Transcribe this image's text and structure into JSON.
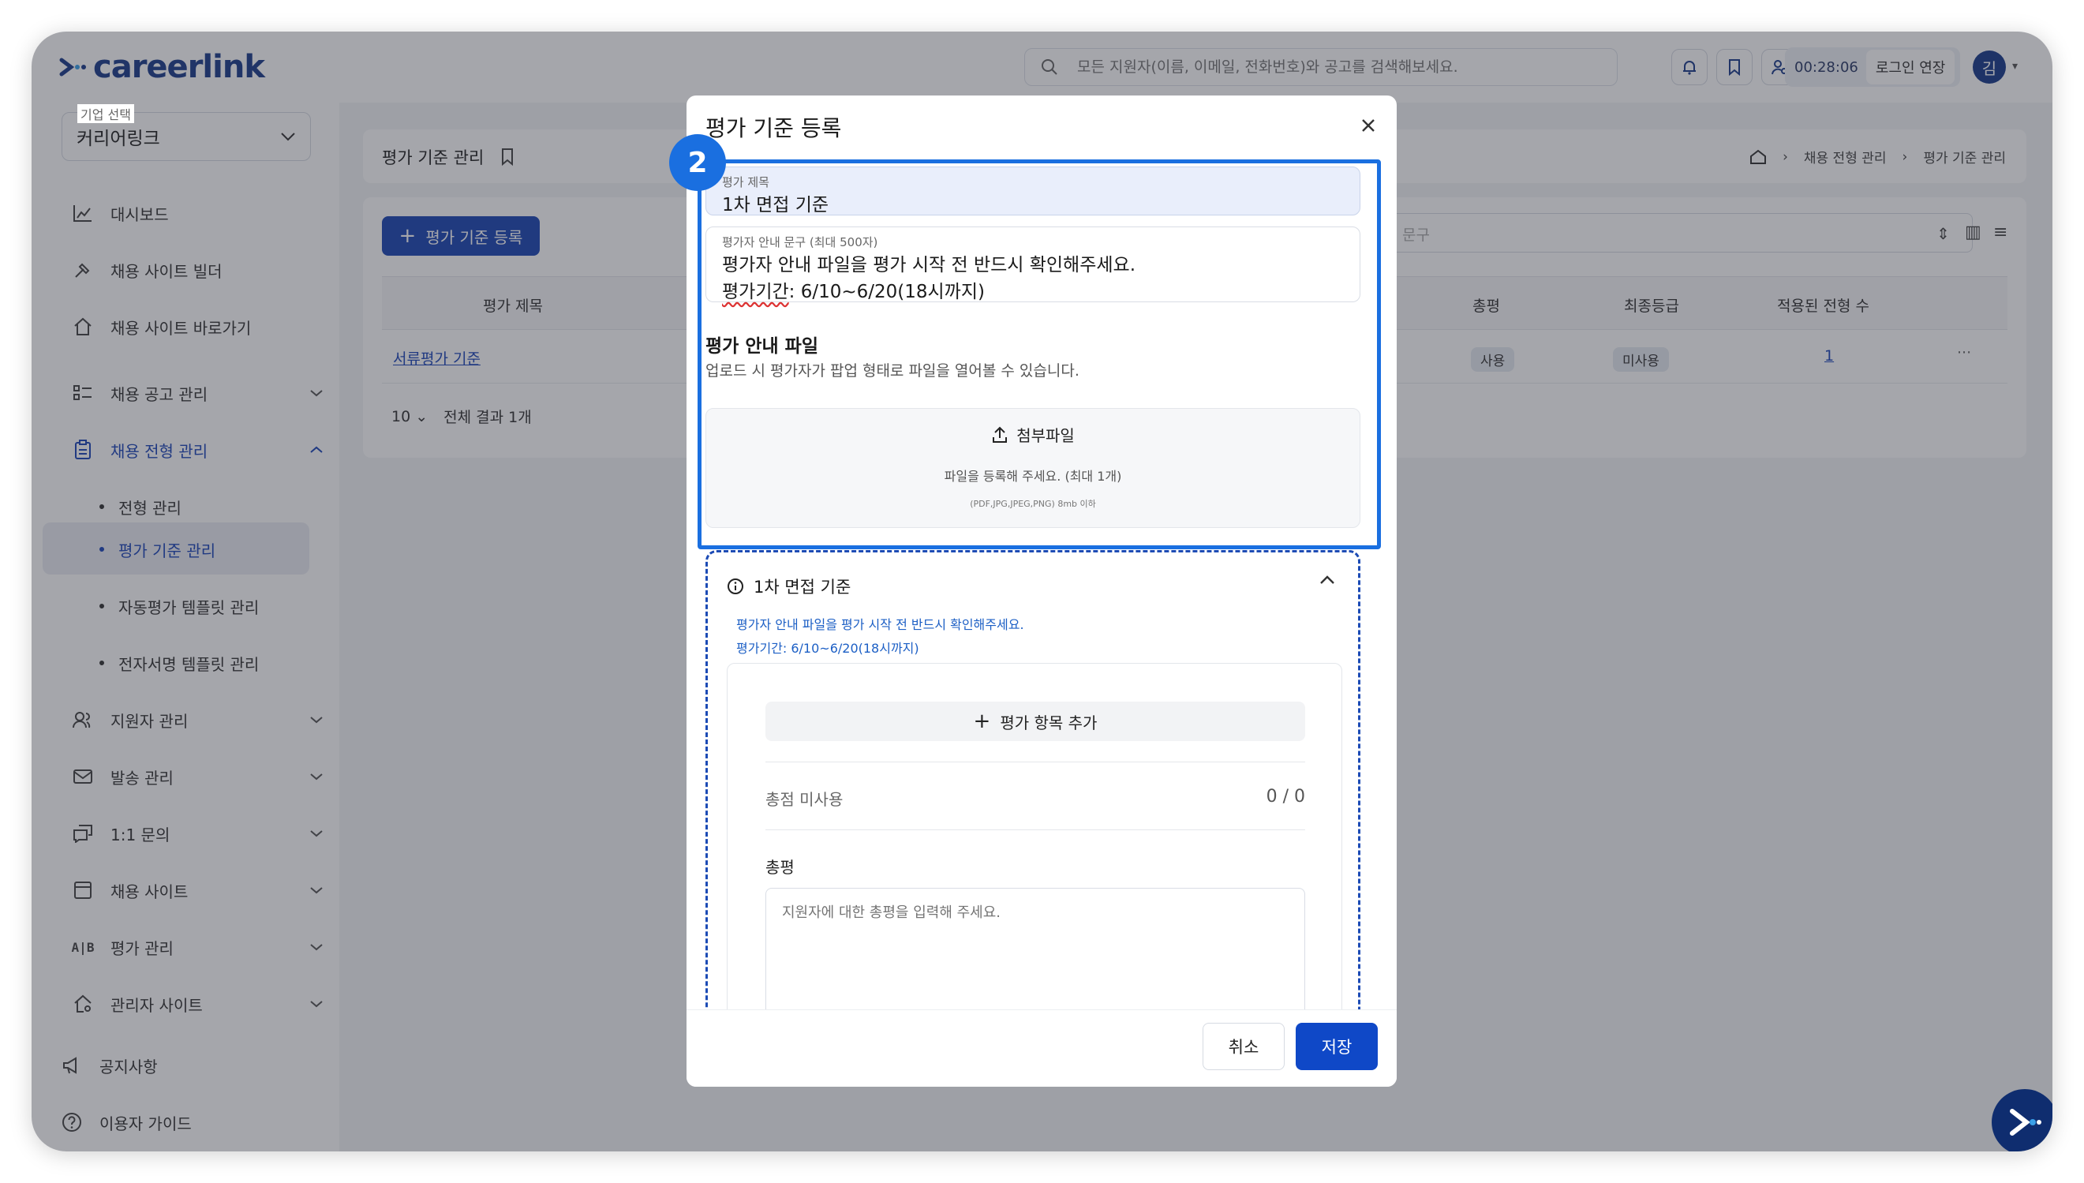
{
  "app": {
    "logo_text": "careerlink",
    "search_placeholder": "모든 지원자(이름, 이메일, 전화번호)와 공고를 검색해보세요.",
    "session_time": "00:28:06",
    "extend_label": "로그인 연장",
    "avatar_initial": "김"
  },
  "sidebar": {
    "company_label": "기업 선택",
    "company_value": "커리어링크",
    "items": [
      {
        "label": "대시보드",
        "icon": "dashboard-icon"
      },
      {
        "label": "채용 사이트 빌더",
        "icon": "builder-icon"
      },
      {
        "label": "채용 사이트 바로가기",
        "icon": "home-link-icon"
      },
      {
        "label": "채용 공고 관리",
        "icon": "list-icon"
      },
      {
        "label": "채용 전형 관리",
        "icon": "clipboard-icon"
      },
      {
        "label": "지원자 관리",
        "icon": "users-icon"
      },
      {
        "label": "발송 관리",
        "icon": "mail-icon"
      },
      {
        "label": "1:1 문의",
        "icon": "chat-icon"
      },
      {
        "label": "채용 사이트",
        "icon": "window-icon"
      },
      {
        "label": "평가 관리",
        "icon": "ab-icon"
      },
      {
        "label": "관리자 사이트",
        "icon": "admin-home-icon"
      },
      {
        "label": "공지사항",
        "icon": "megaphone-icon"
      },
      {
        "label": "이용자 가이드",
        "icon": "help-icon"
      }
    ],
    "sub_items": [
      "전형 관리",
      "평가 기준 관리",
      "자동평가 템플릿 관리",
      "전자서명 템플릿 관리"
    ]
  },
  "page": {
    "title": "평가 기준 관리",
    "breadcrumb": [
      "채용 전형 관리",
      "평가 기준 관리"
    ],
    "add_button": "평가 기준 등록",
    "search_placeholder_fragment": "문구",
    "table_headers": [
      "평가 제목",
      "총평",
      "최종등급",
      "적용된 전형 수"
    ],
    "row": {
      "title": "서류평가 기준",
      "review": "사용",
      "grade": "미사용",
      "count": "1",
      "more": "···"
    },
    "page_size": "10",
    "result_count": "전체 결과 1개"
  },
  "modal": {
    "title": "평가 기준 등록",
    "step_number": "2",
    "eval_title_label": "평가 제목",
    "eval_title_value": "1차 면접 기준",
    "guide_label": "평가자 안내 문구 (최대 500자)",
    "guide_line1": "평가자 안내 파일을 평가 시작 전 반드시 확인해주세요.",
    "guide_line2a": "평가기간",
    "guide_line2b": ": 6/10~6/20(18시까지)",
    "file_section_title": "평가 안내 파일",
    "file_section_desc": "업로드 시 평가자가 팝업 형태로 파일을 열어볼 수 있습니다.",
    "attach_label": "첨부파일",
    "attach_hint": "파일을 등록해 주세요. (최대 1개)",
    "attach_formats": "(PDF,JPG,JPEG,PNG) 8mb 이하",
    "preview_title": "1차 면접 기준",
    "preview_note1": "평가자 안내 파일을 평가 시작 전 반드시 확인해주세요.",
    "preview_note2": "평가기간: 6/10~6/20(18시까지)",
    "add_item_label": "평가 항목 추가",
    "total_label": "총점 미사용",
    "total_score": "0 / 0",
    "review_label": "총평",
    "review_placeholder": "지원자에 대한 총평을 입력해 주세요.",
    "cancel": "취소",
    "save": "저장"
  },
  "colors": {
    "brand": "#1b46b3",
    "highlight": "#1a6fe0",
    "save": "#0f48c7"
  }
}
